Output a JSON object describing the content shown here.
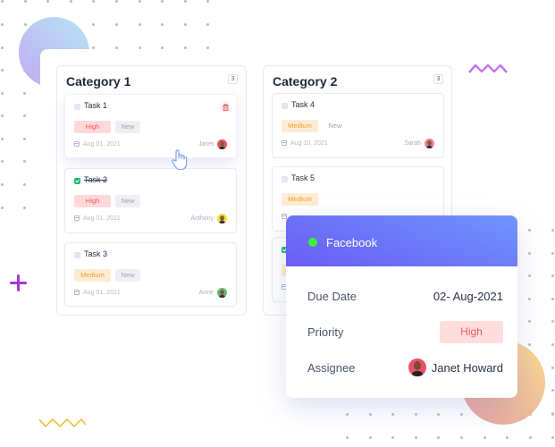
{
  "board": {
    "columns": [
      {
        "title": "Category 1",
        "count": "3",
        "tasks": [
          {
            "name": "Task 1",
            "done": false,
            "priority": "High",
            "status": "New",
            "date": "Aug 01, 2021",
            "assignee": "Janet"
          },
          {
            "name": "Task 2",
            "done": true,
            "priority": "High",
            "status": "New",
            "date": "Aug 01, 2021",
            "assignee": "Anthony"
          },
          {
            "name": "Task 3",
            "done": false,
            "priority": "Medium",
            "status": "New",
            "date": "Aug 01, 2021",
            "assignee": "Anne"
          }
        ]
      },
      {
        "title": "Category 2",
        "count": "3",
        "tasks": [
          {
            "name": "Task 4",
            "done": false,
            "priority": "Medium",
            "status": "New",
            "date": "Aug 10, 2021",
            "assignee": "Sarah"
          },
          {
            "name": "Task 5",
            "done": false,
            "priority": "Medium"
          },
          {
            "done": true
          }
        ]
      }
    ]
  },
  "popup": {
    "title": "Facebook",
    "status_color": "#3bf03b",
    "fields": {
      "due_date_label": "Due Date",
      "due_date_value": "02- Aug-2021",
      "priority_label": "Priority",
      "priority_value": "High",
      "assignee_label": "Assignee",
      "assignee_value": "Janet Howard"
    }
  },
  "icons": {
    "delete": "trash-icon",
    "cursor": "pointer-hand-icon",
    "calendar": "calendar-icon",
    "checkbox": "checkbox-icon"
  },
  "colors": {
    "accent": "#6a5cf6",
    "high": "#f0565a",
    "medium": "#f29e28",
    "done": "#19b96a"
  }
}
